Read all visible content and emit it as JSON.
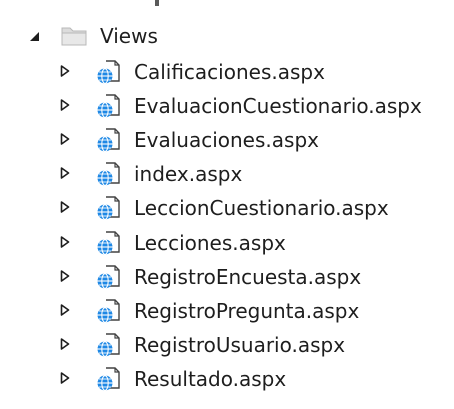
{
  "tree": {
    "folder": {
      "label": "Views",
      "expanded": true,
      "icon": "folder-icon",
      "expander_icon": "expanded-triangle-icon"
    },
    "file_icon": "aspx-web-file-icon",
    "collapsed_expander_icon": "collapsed-triangle-icon",
    "files": [
      {
        "label": "Calificaciones.aspx"
      },
      {
        "label": "EvaluacionCuestionario.aspx"
      },
      {
        "label": "Evaluaciones.aspx"
      },
      {
        "label": "index.aspx"
      },
      {
        "label": "LeccionCuestionario.aspx"
      },
      {
        "label": "Lecciones.aspx"
      },
      {
        "label": "RegistroEncuesta.aspx"
      },
      {
        "label": "RegistroPregunta.aspx"
      },
      {
        "label": "RegistroUsuario.aspx"
      },
      {
        "label": "Resultado.aspx"
      }
    ]
  },
  "colors": {
    "text": "#1e1e1e",
    "expander": "#1e1e1e",
    "folder_fill": "#dcdcdc",
    "folder_stroke": "#b8b8b8",
    "globe_blue": "#1e88e5",
    "page_stroke": "#424242"
  }
}
